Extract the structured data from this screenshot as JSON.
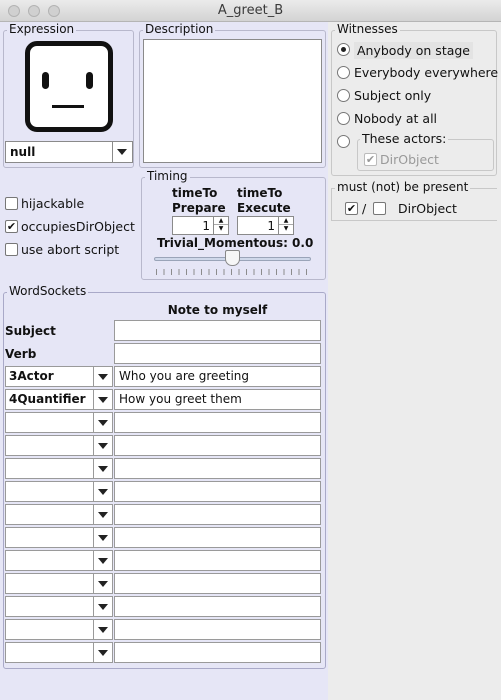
{
  "window": {
    "title": "A_greet_B"
  },
  "expression": {
    "label": "Expression",
    "face_icon": "neutral-face-icon",
    "selected": "null"
  },
  "description": {
    "label": "Description",
    "value": ""
  },
  "options": [
    {
      "label": "hijackable",
      "checked": false
    },
    {
      "label": "occupiesDirObject",
      "checked": true
    },
    {
      "label": "use abort script",
      "checked": false
    }
  ],
  "timing": {
    "label": "Timing",
    "prepare_label_1": "timeTo",
    "prepare_label_2": "Prepare",
    "prepare_value": "1",
    "execute_label_1": "timeTo",
    "execute_label_2": "Execute",
    "execute_value": "1",
    "trivial_label": "Trivial_Momentous: 0.0",
    "trivial_value": 0.0
  },
  "witnesses": {
    "label": "Witnesses",
    "options": [
      {
        "label": "Anybody on stage",
        "selected": true
      },
      {
        "label": "Everybody everywhere",
        "selected": false
      },
      {
        "label": "Subject only",
        "selected": false
      },
      {
        "label": "Nobody at all",
        "selected": false
      },
      {
        "label": "These actors:",
        "selected": false
      }
    ],
    "these_actors": {
      "label": "DirObject",
      "checked": true
    }
  },
  "presence": {
    "label": "must (not) be present",
    "separator": "/",
    "item_label": "DirObject",
    "must_checked": true,
    "not_checked": false
  },
  "wordsockets": {
    "label": "WordSockets",
    "note_header": "Note to myself",
    "rows": [
      {
        "socket": "Subject",
        "note": ""
      },
      {
        "socket": "Verb",
        "note": ""
      },
      {
        "socket": "3Actor",
        "note": "Who you are greeting"
      },
      {
        "socket": "4Quantifier",
        "note": "How you greet them"
      },
      {
        "socket": "",
        "note": ""
      },
      {
        "socket": "",
        "note": ""
      },
      {
        "socket": "",
        "note": ""
      },
      {
        "socket": "",
        "note": ""
      },
      {
        "socket": "",
        "note": ""
      },
      {
        "socket": "",
        "note": ""
      },
      {
        "socket": "",
        "note": ""
      },
      {
        "socket": "",
        "note": ""
      },
      {
        "socket": "",
        "note": ""
      },
      {
        "socket": "",
        "note": ""
      },
      {
        "socket": "",
        "note": ""
      }
    ]
  }
}
